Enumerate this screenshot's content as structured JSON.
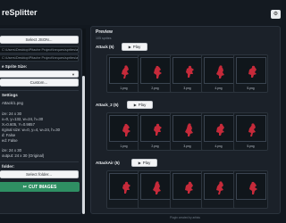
{
  "app": {
    "title": "reSplitter"
  },
  "sidebar": {
    "select_json_label": "Select JSON...",
    "json_path": "C:\\Users\\Desktop\\Pitache Project\\heques\\sprites\\attack.json",
    "image_path": "C:\\Users\\Desktop\\Pitache Project\\heques\\sprites\\attack.png",
    "sprite_size_label": "e Sprite Size:",
    "sprite_size_value": "",
    "custom_label": "Custom...",
    "settings_label": "Settings",
    "settings_lines": [
      "Attack/1.png",
      "",
      "ize: 24 x 30",
      "x=0, y=132, w=24, h=30",
      "X=0.605, Y=0.9857",
      "riginal size: w=0, y=4, w=24, h=30",
      "d: False",
      "ed: False",
      "",
      "ize: 24 x 30",
      "output: 24 x 30 (Original)"
    ],
    "output_folder_label": "folder:",
    "select_folder_label": "Select folder...",
    "cut_images_label": "CUT IMAGES"
  },
  "preview": {
    "title": "Preview",
    "subtitle": "105 sprites",
    "play_label": "Play",
    "groups": [
      {
        "name": "Attack",
        "count": "(5)",
        "frames": [
          "1.png",
          "2.png",
          "3.png",
          "4.png",
          "5.png"
        ]
      },
      {
        "name": "Attack_2",
        "count": "(5)",
        "frames": [
          "1.png",
          "2.png",
          "3.png",
          "4.png",
          "5.png"
        ]
      },
      {
        "name": "AttackAir",
        "count": "(5)",
        "frames": [
          "",
          "",
          "",
          "",
          ""
        ]
      }
    ]
  },
  "footer": {
    "credit": "Plugin created by artists"
  },
  "colors": {
    "accent_green": "#2f8f63",
    "sprite_red": "#c62a3a",
    "bg": "#12181f",
    "panel": "#1b2129"
  }
}
